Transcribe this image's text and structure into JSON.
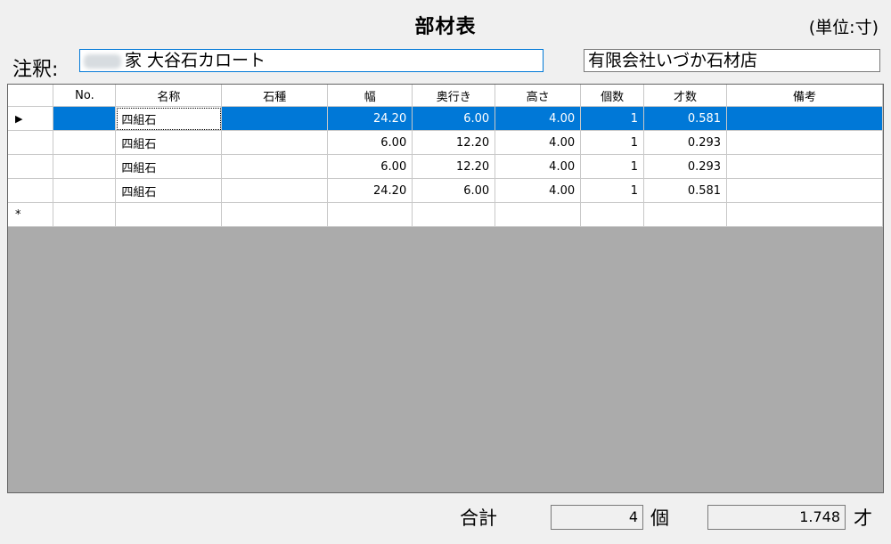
{
  "header": {
    "title": "部材表",
    "unit": "(単位:寸)"
  },
  "note": {
    "label": "注釈:",
    "value": "家  大谷石カロート"
  },
  "company": "有限会社いづか石材店",
  "grid": {
    "columns": [
      "No.",
      "名称",
      "石種",
      "幅",
      "奥行き",
      "高さ",
      "個数",
      "才数",
      "備考"
    ],
    "rows": [
      {
        "no": "",
        "name": "四組石",
        "stone": "",
        "width": "24.20",
        "depth": "6.00",
        "height": "4.00",
        "count": "1",
        "sai": "0.581",
        "note": ""
      },
      {
        "no": "",
        "name": "四組石",
        "stone": "",
        "width": "6.00",
        "depth": "12.20",
        "height": "4.00",
        "count": "1",
        "sai": "0.293",
        "note": ""
      },
      {
        "no": "",
        "name": "四組石",
        "stone": "",
        "width": "6.00",
        "depth": "12.20",
        "height": "4.00",
        "count": "1",
        "sai": "0.293",
        "note": ""
      },
      {
        "no": "",
        "name": "四組石",
        "stone": "",
        "width": "24.20",
        "depth": "6.00",
        "height": "4.00",
        "count": "1",
        "sai": "0.581",
        "note": ""
      }
    ],
    "current_row_glyph": "▶",
    "new_row_glyph": "*"
  },
  "footer": {
    "total_label": "合計",
    "total_count": "4",
    "count_unit": "個",
    "total_sai": "1.748",
    "sai_unit": "才"
  },
  "colors": {
    "selection": "#0078d7",
    "empty_area": "#ababab",
    "background": "#f0f0f0"
  }
}
